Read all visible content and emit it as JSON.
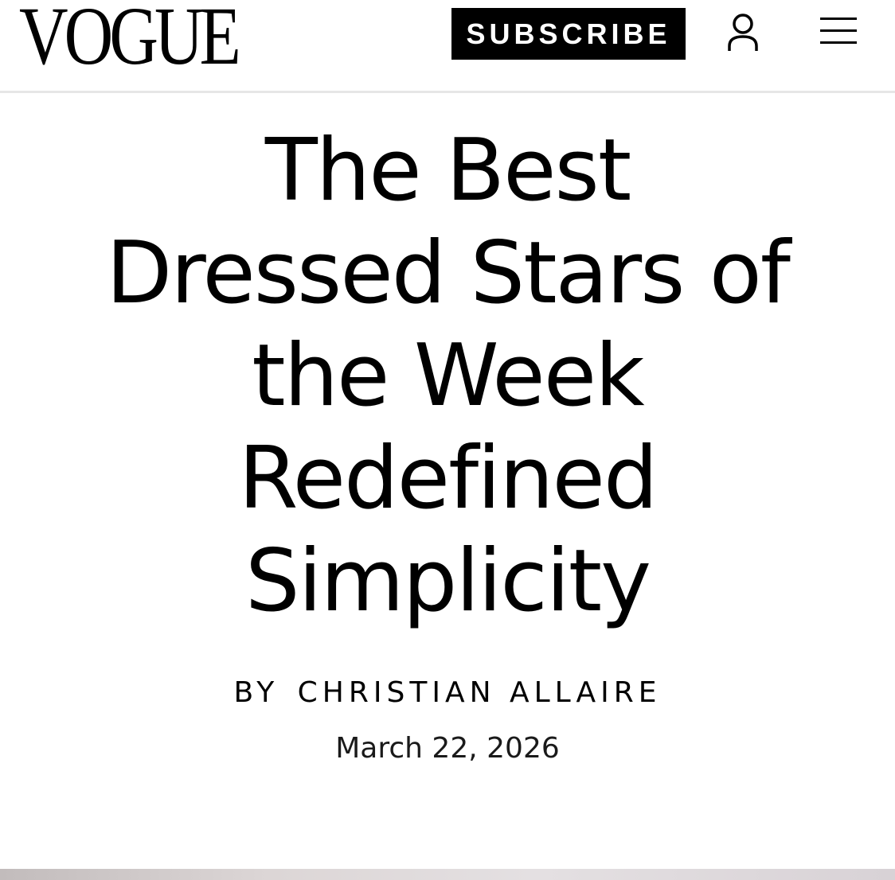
{
  "header": {
    "logo_text": "VOGUE",
    "subscribe_label": "SUBSCRIBE",
    "account_icon": "user-icon",
    "menu_icon": "hamburger-menu-icon"
  },
  "article": {
    "headline_lines": [
      "The Best",
      "Dressed Stars of",
      "the Week",
      "Redefined",
      "Simplicity"
    ],
    "byline_prefix": "BY",
    "author": "CHRISTIAN ALLAIRE",
    "date": "March 22, 2026"
  },
  "colors": {
    "brand": "#000000",
    "background": "#ffffff",
    "header_divider": "#e6e6e6",
    "overlay_pill": "#6a6a6a"
  }
}
